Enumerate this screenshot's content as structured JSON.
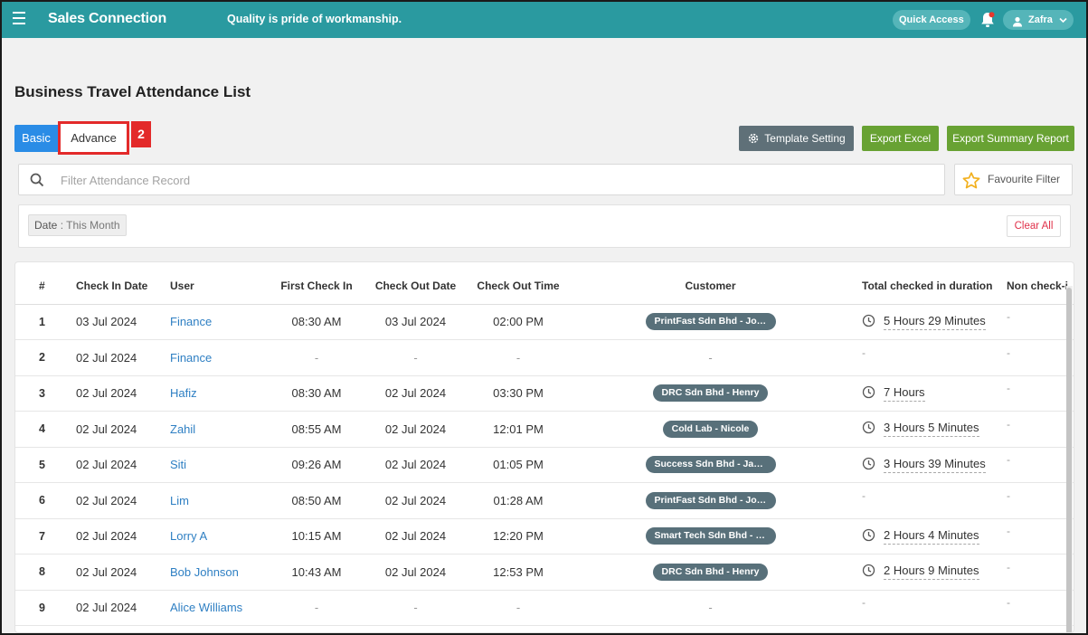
{
  "header": {
    "app_title": "Sales Connection",
    "tagline": "Quality is pride of workmanship.",
    "quick_access_label": "Quick Access",
    "user_name": "Zafra",
    "accent_color": "#2a9aa0"
  },
  "page": {
    "title": "Business Travel Attendance List"
  },
  "tabs": {
    "basic_label": "Basic",
    "advance_label": "Advance",
    "step_badge": "2"
  },
  "toolbar": {
    "template_setting_label": "Template Setting",
    "export_excel_label": "Export Excel",
    "export_summary_label": "Export Summary Report"
  },
  "filter": {
    "placeholder": "Filter Attendance Record",
    "favourite_label": "Favourite Filter",
    "chip_key": "Date",
    "chip_separator": " : ",
    "chip_value": "This Month",
    "clear_all_label": "Clear All"
  },
  "table": {
    "columns": [
      "#",
      "Check In Date",
      "User",
      "First Check In",
      "Check Out Date",
      "Check Out Time",
      "Customer",
      "Total checked in duration",
      "Non check-i"
    ],
    "rows": [
      {
        "num": "1",
        "check_in_date": "03 Jul 2024",
        "user": "Finance",
        "first_check_in": "08:30 AM",
        "check_out_date": "03 Jul 2024",
        "check_out_time": "02:00 PM",
        "customer": "PrintFast Sdn Bhd - Joh...",
        "duration": "5 Hours 29 Minutes",
        "non_check_in": "-"
      },
      {
        "num": "2",
        "check_in_date": "02 Jul 2024",
        "user": "Finance",
        "first_check_in": "-",
        "check_out_date": "-",
        "check_out_time": "-",
        "customer": "-",
        "duration": "-",
        "non_check_in": "-"
      },
      {
        "num": "3",
        "check_in_date": "02 Jul 2024",
        "user": "Hafiz",
        "first_check_in": "08:30 AM",
        "check_out_date": "02 Jul 2024",
        "check_out_time": "03:30 PM",
        "customer": "DRC Sdn Bhd - Henry",
        "duration": "7 Hours",
        "non_check_in": "-"
      },
      {
        "num": "4",
        "check_in_date": "02 Jul 2024",
        "user": "Zahil",
        "first_check_in": "08:55 AM",
        "check_out_date": "02 Jul 2024",
        "check_out_time": "12:01 PM",
        "customer": "Cold Lab - Nicole",
        "duration": "3 Hours 5 Minutes",
        "non_check_in": "-"
      },
      {
        "num": "5",
        "check_in_date": "02 Jul 2024",
        "user": "Siti",
        "first_check_in": "09:26 AM",
        "check_out_date": "02 Jul 2024",
        "check_out_time": "01:05 PM",
        "customer": "Success Sdn Bhd - Jam...",
        "duration": "3 Hours 39 Minutes",
        "non_check_in": "-"
      },
      {
        "num": "6",
        "check_in_date": "02 Jul 2024",
        "user": "Lim",
        "first_check_in": "08:50 AM",
        "check_out_date": "02 Jul 2024",
        "check_out_time": "01:28 AM",
        "customer": "PrintFast Sdn Bhd - Joh...",
        "duration": "-",
        "non_check_in": "-"
      },
      {
        "num": "7",
        "check_in_date": "02 Jul 2024",
        "user": "Lorry A",
        "first_check_in": "10:15 AM",
        "check_out_date": "02 Jul 2024",
        "check_out_time": "12:20 PM",
        "customer": "Smart Tech Sdn Bhd - J...",
        "duration": "2 Hours 4 Minutes",
        "non_check_in": "-"
      },
      {
        "num": "8",
        "check_in_date": "02 Jul 2024",
        "user": "Bob Johnson",
        "first_check_in": "10:43 AM",
        "check_out_date": "02 Jul 2024",
        "check_out_time": "12:53 PM",
        "customer": "DRC Sdn Bhd - Henry",
        "duration": "2 Hours 9 Minutes",
        "non_check_in": "-"
      },
      {
        "num": "9",
        "check_in_date": "02 Jul 2024",
        "user": "Alice Williams",
        "first_check_in": "-",
        "check_out_date": "-",
        "check_out_time": "-",
        "customer": "-",
        "duration": "-",
        "non_check_in": "-"
      }
    ]
  }
}
